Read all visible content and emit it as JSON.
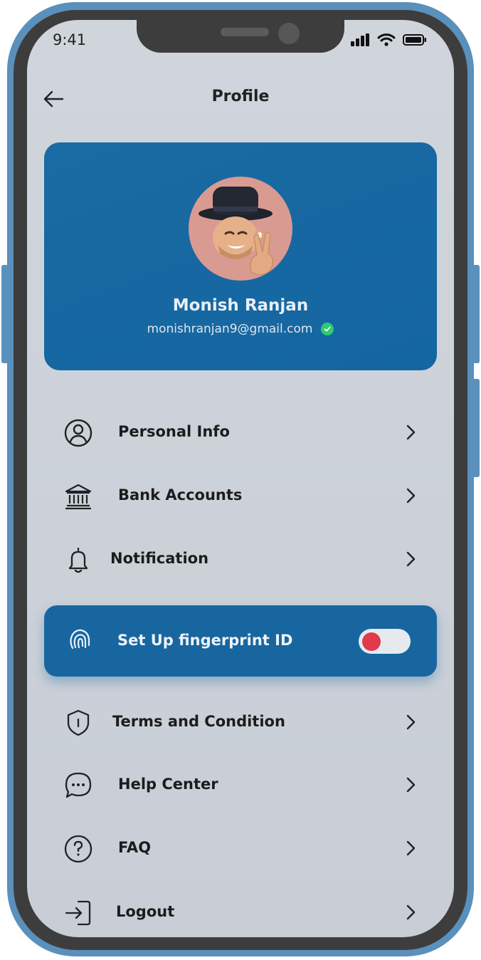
{
  "status_bar": {
    "time": "9:41"
  },
  "header": {
    "title": "Profile"
  },
  "profile": {
    "name": "Monish Ranjan",
    "email": "monishranjan9@gmail.com"
  },
  "menu": {
    "personal_info": "Personal Info",
    "bank_accounts": "Bank Accounts",
    "notification": "Notification",
    "fingerprint": "Set Up fingerprint ID",
    "terms": "Terms and Condition",
    "help": "Help Center",
    "faq": "FAQ",
    "logout": "Logout"
  },
  "fingerprint_enabled": false,
  "colors": {
    "accent": "#1766a0",
    "toggle_off_knob": "#e03a4b",
    "verified": "#2ecc71",
    "avatar_bg": "#d99a92"
  }
}
